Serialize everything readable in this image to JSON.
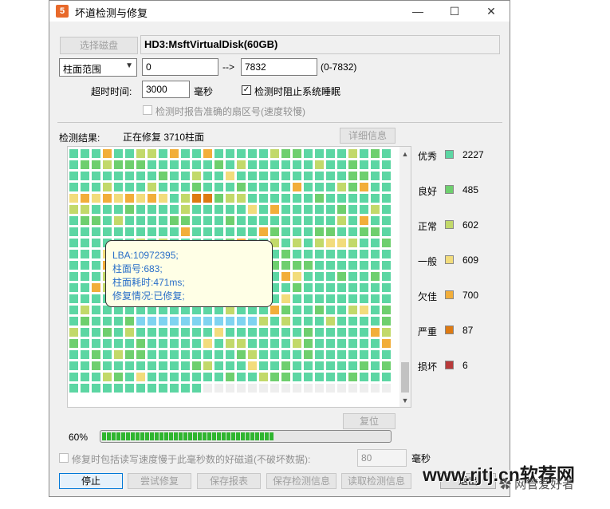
{
  "window": {
    "title": "坏道检测与修复",
    "min_icon": "—",
    "max_icon": "☐",
    "close_icon": "✕",
    "app_icon_glyph": "5"
  },
  "disk": {
    "select_button": "选择磁盘",
    "name": "HD3:MsftVirtualDisk(60GB)"
  },
  "range": {
    "mode": "柱面范围",
    "start": "0",
    "arrow": "-->",
    "end": "7832",
    "hint": "(0-7832)"
  },
  "timeout": {
    "label": "超时时间:",
    "value": "3000",
    "unit": "毫秒",
    "prevent_sleep_label": "检测时阻止系统睡眠",
    "prevent_sleep_checked": true,
    "report_sector_label": "检测时报告准确的扇区号(速度较慢)",
    "report_sector_checked": false
  },
  "result": {
    "label": "检测结果:",
    "status": "正在修复 3710柱面",
    "detail_button": "详细信息"
  },
  "legend": [
    {
      "name": "优秀",
      "color": "#5cd6a3",
      "count": "2227"
    },
    {
      "name": "良好",
      "color": "#6ecf6e",
      "count": "485"
    },
    {
      "name": "正常",
      "color": "#c2d96a",
      "count": "602"
    },
    {
      "name": "一般",
      "color": "#f2dc7c",
      "count": "609"
    },
    {
      "name": "欠佳",
      "color": "#f2ae3a",
      "count": "700"
    },
    {
      "name": "严重",
      "color": "#de7a12",
      "count": "87"
    },
    {
      "name": "损坏",
      "color": "#b83a3a",
      "count": "6"
    }
  ],
  "tooltip": {
    "lines": [
      "LBA:10972395;",
      "柱面号:683;",
      "柱面耗时:471ms;",
      "修复情况:已修复;"
    ]
  },
  "reset_button": "复位",
  "progress": {
    "label": "60%",
    "fraction": 0.6
  },
  "bottom_option": {
    "label": "修复时包括读写速度慢于此毫秒数的好磁道(不破坏数据):",
    "value": "80",
    "unit": "毫秒",
    "checked": false
  },
  "buttons": {
    "stop": "停止",
    "try_repair": "尝试修复",
    "save_report": "保存报表",
    "save_info": "保存检测信息",
    "load_info": "读取检测信息",
    "exit": "退出"
  },
  "watermark": {
    "site": "www.rjtj.cn软荐网",
    "account": "网管爱好者"
  }
}
